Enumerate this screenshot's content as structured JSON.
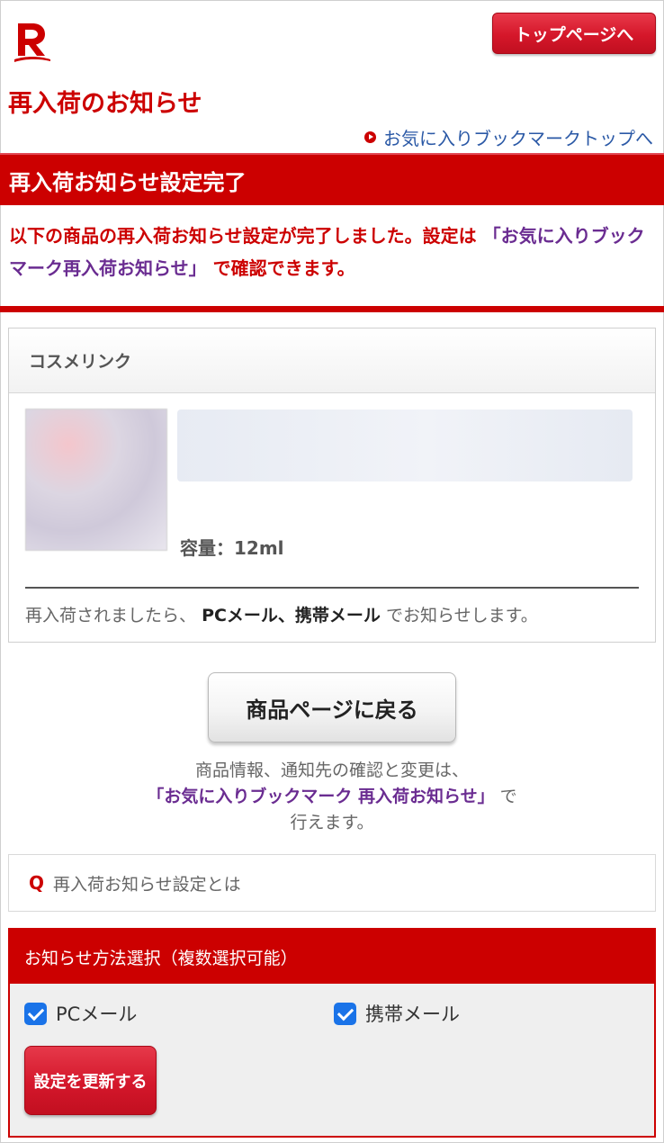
{
  "header": {
    "logo_icon": "rakuten-r-logo-icon",
    "top_page_button": "トップページへ",
    "title": "再入荷のお知らせ",
    "bookmark_link": "お気に入りブックマークトップへ"
  },
  "banner": {
    "title": "再入荷お知らせ設定完了"
  },
  "notice": {
    "text_part1": "以下の商品の再入荷お知らせ設定が完了しました。設定は",
    "text_link": "「お気に入りブックマーク再入荷お知らせ」",
    "text_part2": "で確認できます。"
  },
  "item": {
    "shop_name": "コスメリンク",
    "capacity": "容量：12ml",
    "notify_prefix": "再入荷されましたら、",
    "notify_methods": "PCメール、携帯メール",
    "notify_suffix": "でお知らせします。"
  },
  "actions": {
    "back_button": "商品ページに戻る",
    "info_line1": "商品情報、通知先の確認と変更は、",
    "info_link": "「お気に入りブックマーク 再入荷お知らせ」",
    "info_line2_suffix": "で",
    "info_line3": "行えます。"
  },
  "faq": {
    "q_mark": "Q",
    "label": "再入荷お知らせ設定とは"
  },
  "method_select": {
    "heading": "お知らせ方法選択（複数選択可能）",
    "options": [
      {
        "label": "PCメール",
        "checked": true
      },
      {
        "label": "携帯メール",
        "checked": true
      }
    ],
    "update_button": "設定を更新する"
  },
  "colors": {
    "brand_red": "#cc0000",
    "link_blue": "#2b59a6",
    "link_purple": "#6a2c91",
    "checkbox_blue": "#1a73e8"
  }
}
